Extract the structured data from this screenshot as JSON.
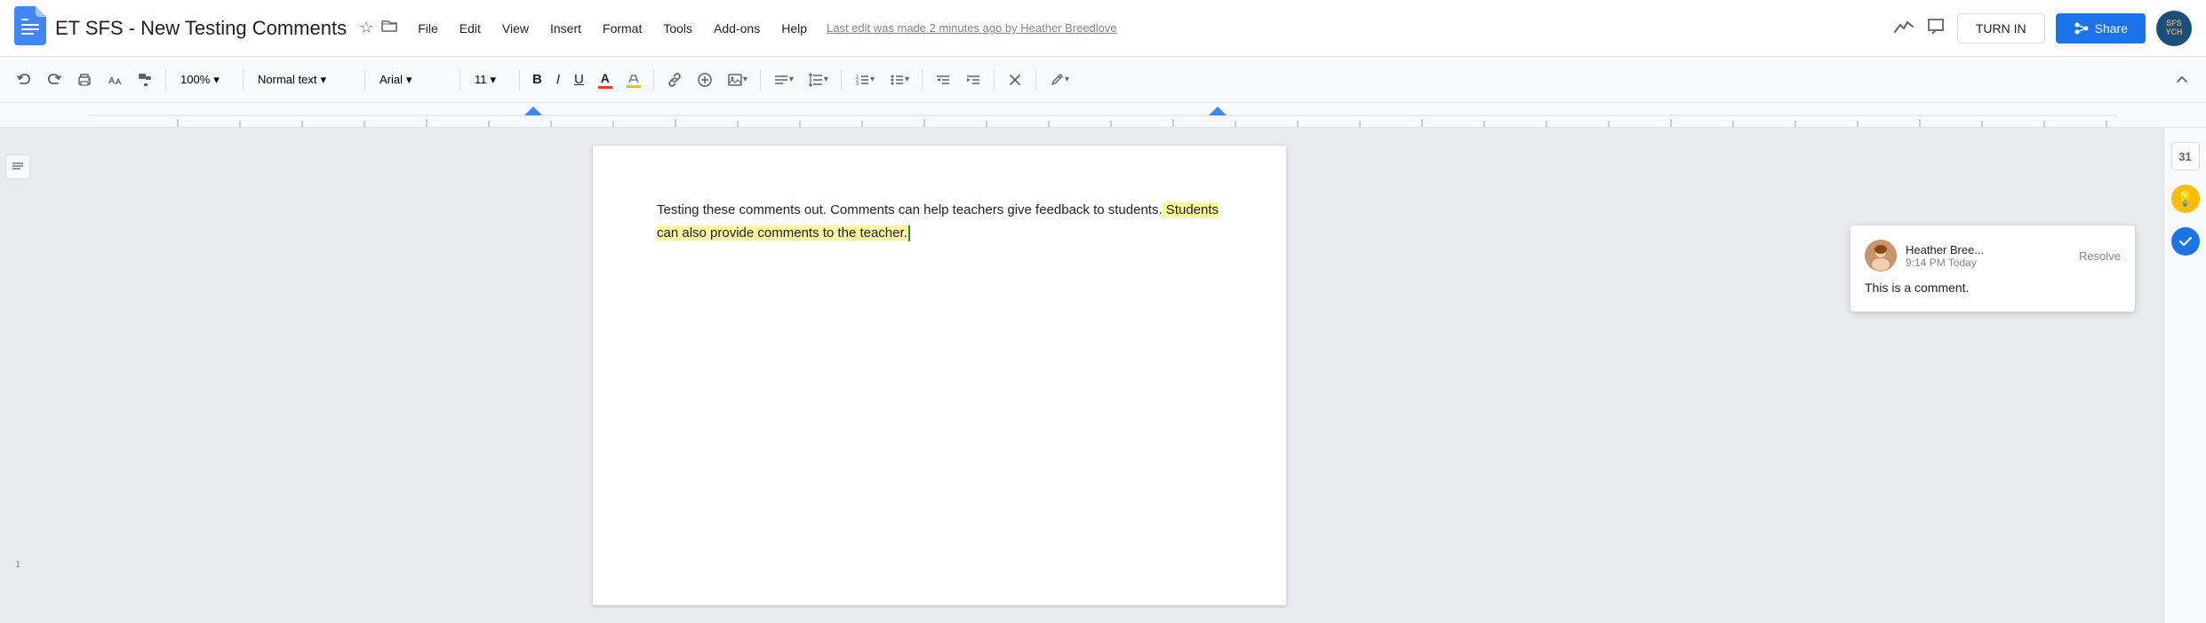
{
  "title_bar": {
    "doc_title": "ET SFS - New Testing Comments",
    "star_tooltip": "Star",
    "folder_tooltip": "Move to folder",
    "last_edit": "Last edit was made 2 minutes ago by Heather Breedlove",
    "turn_in_label": "TURN IN",
    "share_label": "Share",
    "user_initials": "SFS\nYCH"
  },
  "menu": {
    "items": [
      "File",
      "Edit",
      "View",
      "Insert",
      "Format",
      "Tools",
      "Add-ons",
      "Help"
    ]
  },
  "toolbar": {
    "zoom": "100%",
    "style": "Normal text",
    "font": "Arial",
    "size": "11",
    "undo": "↩",
    "redo": "↪",
    "print": "🖨",
    "paint_format": "🖌",
    "bold": "B",
    "italic": "I",
    "underline": "U",
    "align": "≡",
    "line_spacing": "↕",
    "numbered_list": "☰",
    "bulleted_list": "⊙",
    "indent_less": "⇤",
    "indent_more": "⇥",
    "clear_format": "✕",
    "edit_icon": "✏",
    "chevron_up": "∧"
  },
  "doc": {
    "content_normal": "Testing these comments out. Comments can help teachers give feedback to students.",
    "content_highlighted": " Students can also provide comments to the teacher.",
    "cursor": true
  },
  "comment": {
    "author": "Heather Bree...",
    "time": "9:14 PM Today",
    "text": "This is a comment.",
    "resolve_label": "Resolve"
  },
  "side_icons": {
    "explore": "💡",
    "tasks": "✓"
  },
  "calendar": {
    "label": "31"
  }
}
